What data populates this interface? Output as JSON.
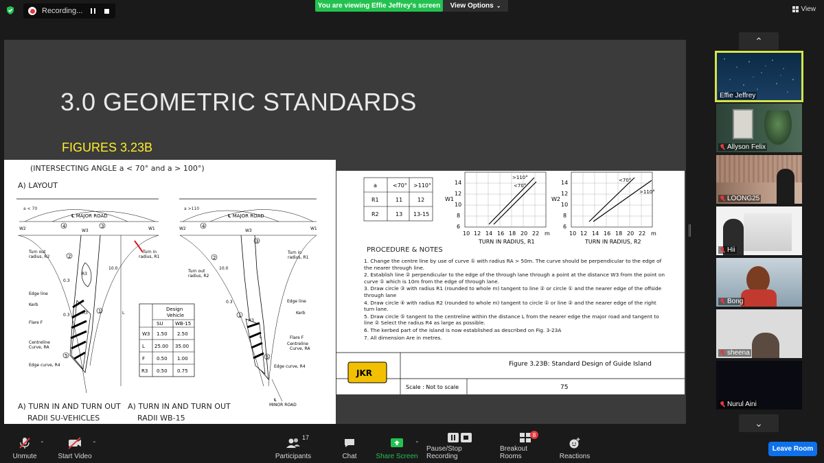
{
  "topbar": {
    "recording_label": "Recording...",
    "viewing_banner": "You are viewing Effie Jeffrey's screen",
    "view_options": "View Options",
    "view_button": "View"
  },
  "slide": {
    "title": "3.0 GEOMETRIC STANDARDS",
    "figure_label": "FIGURES 3.23B",
    "left_figure": {
      "heading": "(INTERSECTING ANGLE a < 70° and a > 100°)",
      "layout_label": "A)  LAYOUT",
      "angle_left": "a < 70",
      "angle_right": "a >110",
      "major_road": "℄  MAJOR ROAD",
      "minor_road": "℄\nMINOR ROAD",
      "labels_left": [
        "Turn out radius, R2",
        "Edge line",
        "Kerb",
        "Flare F",
        "Centreline Curve, RA",
        "Edge curve, R4",
        "Turn in radius, R1"
      ],
      "labels_right": [
        "Turn out radius, R2",
        "Turn in radius, R1",
        "Edge line",
        "Kerb",
        "Flare F",
        "Centreline Curve, RA",
        "Edge curve, R4"
      ],
      "dims": [
        "W2",
        "W3",
        "W1",
        "0.3",
        "10.0",
        "R3",
        "L"
      ],
      "table": {
        "header_main": "Design Vehicle",
        "cols": [
          "",
          "SU",
          "WB-15"
        ],
        "rows": [
          [
            "W3",
            "1.50",
            "2.50"
          ],
          [
            "L",
            "25.00",
            "35.00"
          ],
          [
            "F",
            "0.50",
            "1.00"
          ],
          [
            "R3",
            "0.50",
            "0.75"
          ]
        ]
      },
      "caption_left_1": "A)  TURN IN AND TURN OUT",
      "caption_left_2": "RADII SU-VEHICLES",
      "caption_right_1": "A)  TURN IN AND TURN OUT",
      "caption_right_2": "RADII WB-15"
    },
    "right_figure": {
      "small_table": {
        "cols": [
          "a",
          "<70°",
          ">110°"
        ],
        "rows": [
          [
            "R1",
            "11",
            "12"
          ],
          [
            "R2",
            "13",
            "13-15"
          ]
        ]
      },
      "graph1": {
        "ylabel": "W1",
        "xlabel": "TURN IN RADIUS, R1",
        "yticks": [
          "14",
          "12",
          "10",
          "8",
          "6"
        ],
        "xticks": [
          "10",
          "12",
          "14",
          "16",
          "18",
          "20",
          "22",
          "m"
        ],
        "legend": [
          ">110°",
          "<70°"
        ]
      },
      "graph2": {
        "ylabel": "W2",
        "xlabel": "TURN IN RADIUS, R2",
        "yticks": [
          "14",
          "12",
          "10",
          "8",
          "6"
        ],
        "xticks": [
          "10",
          "12",
          "14",
          "16",
          "18",
          "20",
          "22",
          "m"
        ],
        "legend": [
          "<70°",
          ">110°"
        ]
      },
      "procedure_title": "PROCEDURE & NOTES",
      "procedure": [
        "1.  Change the centre line by use of curve ① with radius RA > 50m. The curve should be perpendicular to the edge of the nearer through line.",
        "2.  Establish line ② perpendicular to the edge of the through lane through a point at the distance W3 from the point on curve ① which is 10m from the edge of through lane.",
        "3.  Draw circle ③ with radius R1 (rounded to whole m) tangent to line ② or circle ① and the nearer edge of the offside through lane",
        "4.  Draw circle ④ with radius R2 (rounded to whole m) tangent to circle ① or line ② and the nearer edge of the right turn lane.",
        "5.  Draw circle ⑤ tangent to the centreline within the distance L from the nearer edge the major road and tangent to line ② Select the radius R4 as large as possible.",
        "6.  The kerbed part of the island is now established as described on Fig. 3-23A",
        "7.  All dimension Are in metres."
      ],
      "logo": "JKR",
      "caption": "Figure 3.23B: Standard Design of Guide Island",
      "scale": "Scale : Not to scale",
      "page": "75"
    }
  },
  "participants": [
    {
      "name": "Effie Jeffrey",
      "muted": false,
      "active": true
    },
    {
      "name": "Allyson Felix",
      "muted": true,
      "active": false
    },
    {
      "name": "LOONG25",
      "muted": true,
      "active": false
    },
    {
      "name": "Hii",
      "muted": true,
      "active": false
    },
    {
      "name": "Bong",
      "muted": true,
      "active": false
    },
    {
      "name": "sheena",
      "muted": true,
      "active": false
    },
    {
      "name": "Nurul Aini",
      "muted": true,
      "active": false
    }
  ],
  "toolbar": {
    "unmute": "Unmute",
    "start_video": "Start Video",
    "participants": "Participants",
    "participants_count": "17",
    "chat": "Chat",
    "share_screen": "Share Screen",
    "pause_stop": "Pause/Stop Recording",
    "breakout": "Breakout Rooms",
    "breakout_badge": "8",
    "reactions": "Reactions",
    "leave": "Leave Room"
  },
  "colors": {
    "accent_green": "#23c250",
    "leave_blue": "#0e71eb",
    "speaker_outline": "#d6e44a",
    "muted_red": "#e0393e",
    "figure_label": "#ffef2a"
  }
}
